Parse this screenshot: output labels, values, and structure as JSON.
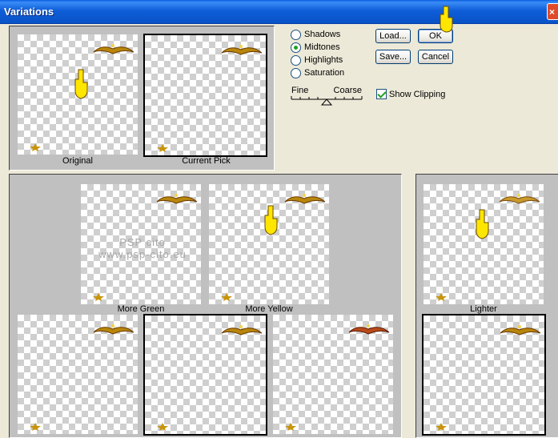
{
  "window": {
    "title": "Variations"
  },
  "top_panel": {
    "original_caption": "Original",
    "current_caption": "Current Pick"
  },
  "options": {
    "radios": [
      {
        "label": "Shadows",
        "checked": false
      },
      {
        "label": "Midtones",
        "checked": true
      },
      {
        "label": "Highlights",
        "checked": false
      },
      {
        "label": "Saturation",
        "checked": false
      }
    ],
    "slider": {
      "left_label": "Fine",
      "right_label": "Coarse"
    },
    "show_clipping": {
      "label": "Show Clipping",
      "checked": true
    }
  },
  "buttons": {
    "load": "Load...",
    "ok": "OK",
    "save": "Save...",
    "cancel": "Cancel"
  },
  "variations": {
    "more_green": "More Green",
    "more_yellow": "More Yellow",
    "lighter": "Lighter"
  },
  "watermark": {
    "line1": "PSP cito",
    "line2": "www.psp-cito.eu"
  },
  "colors": {
    "titlebar": "#0a5fe0",
    "accent": "#21a121",
    "panel": "#c0c0c0"
  }
}
